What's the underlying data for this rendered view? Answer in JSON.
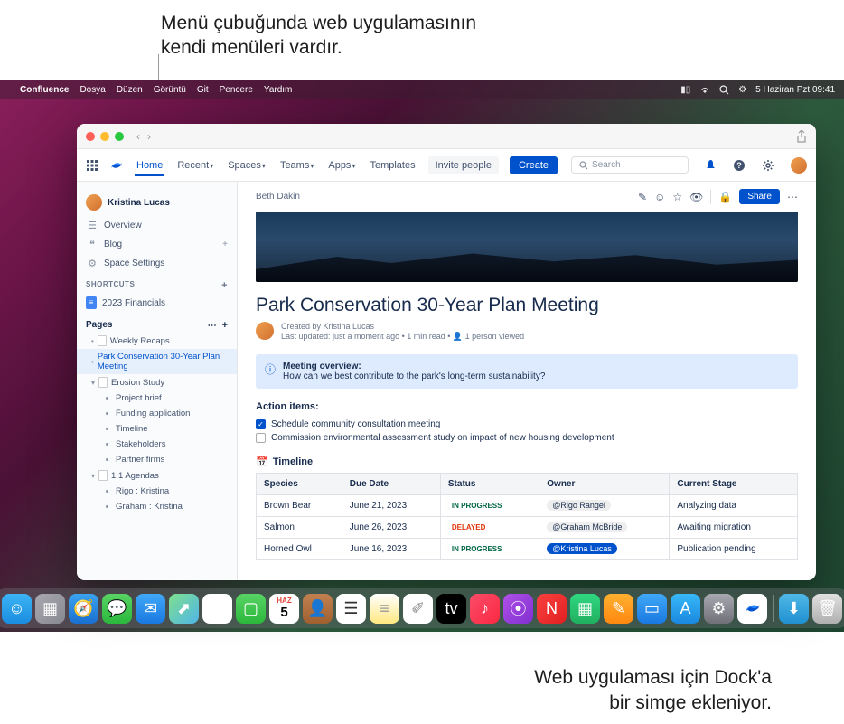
{
  "captions": {
    "top_line1": "Menü çubuğunda web uygulamasının",
    "top_line2": "kendi menüleri vardır.",
    "bottom_line1": "Web uygulaması için Dock'a",
    "bottom_line2": "bir simge ekleniyor."
  },
  "menubar": {
    "app_name": "Confluence",
    "items": [
      "Dosya",
      "Düzen",
      "Görüntü",
      "Git",
      "Pencere",
      "Yardım"
    ],
    "datetime": "5 Haziran Pzt  09:41"
  },
  "conf_nav": {
    "home": "Home",
    "recent": "Recent",
    "spaces": "Spaces",
    "teams": "Teams",
    "apps": "Apps",
    "templates": "Templates",
    "invite": "Invite people",
    "create": "Create",
    "search_placeholder": "Search"
  },
  "sidebar": {
    "user": "Kristina Lucas",
    "overview": "Overview",
    "blog": "Blog",
    "space_settings": "Space Settings",
    "shortcuts_header": "SHORTCUTS",
    "shortcut_item": "2023 Financials",
    "pages_header": "Pages",
    "tree": {
      "weekly": "Weekly Recaps",
      "park": "Park Conservation 30-Year Plan Meeting",
      "erosion": "Erosion Study",
      "project_brief": "Project brief",
      "funding": "Funding application",
      "timeline": "Timeline",
      "stakeholders": "Stakeholders",
      "partner": "Partner firms",
      "agendas": "1:1 Agendas",
      "rigo": "Rigo : Kristina",
      "graham": "Graham : Kristina"
    }
  },
  "page": {
    "breadcrumb": "Beth Dakin",
    "share": "Share",
    "title": "Park Conservation 30-Year Plan Meeting",
    "byline_created": "Created by Kristina Lucas",
    "byline_meta": "Last updated: just a moment ago • 1 min read • 👤 1 person viewed",
    "overview_label": "Meeting overview:",
    "overview_text": "How can we best contribute to the park's long-term sustainability?",
    "action_items_h": "Action items:",
    "action1": "Schedule community consultation meeting",
    "action2": "Commission environmental assessment study on impact of new housing development",
    "timeline_h": "Timeline"
  },
  "table": {
    "headers": [
      "Species",
      "Due Date",
      "Status",
      "Owner",
      "Current Stage"
    ],
    "rows": [
      {
        "species": "Brown Bear",
        "due": "June 21, 2023",
        "status": "IN PROGRESS",
        "status_type": "inprogress",
        "owner": "@Rigo Rangel",
        "owner_me": false,
        "stage": "Analyzing data"
      },
      {
        "species": "Salmon",
        "due": "June 26, 2023",
        "status": "DELAYED",
        "status_type": "delayed",
        "owner": "@Graham McBride",
        "owner_me": false,
        "stage": "Awaiting migration"
      },
      {
        "species": "Horned Owl",
        "due": "June 16, 2023",
        "status": "IN PROGRESS",
        "status_type": "inprogress",
        "owner": "@Kristina Lucas",
        "owner_me": true,
        "stage": "Publication pending"
      }
    ]
  },
  "dock": {
    "calendar_month": "HAZ",
    "calendar_day": "5"
  }
}
